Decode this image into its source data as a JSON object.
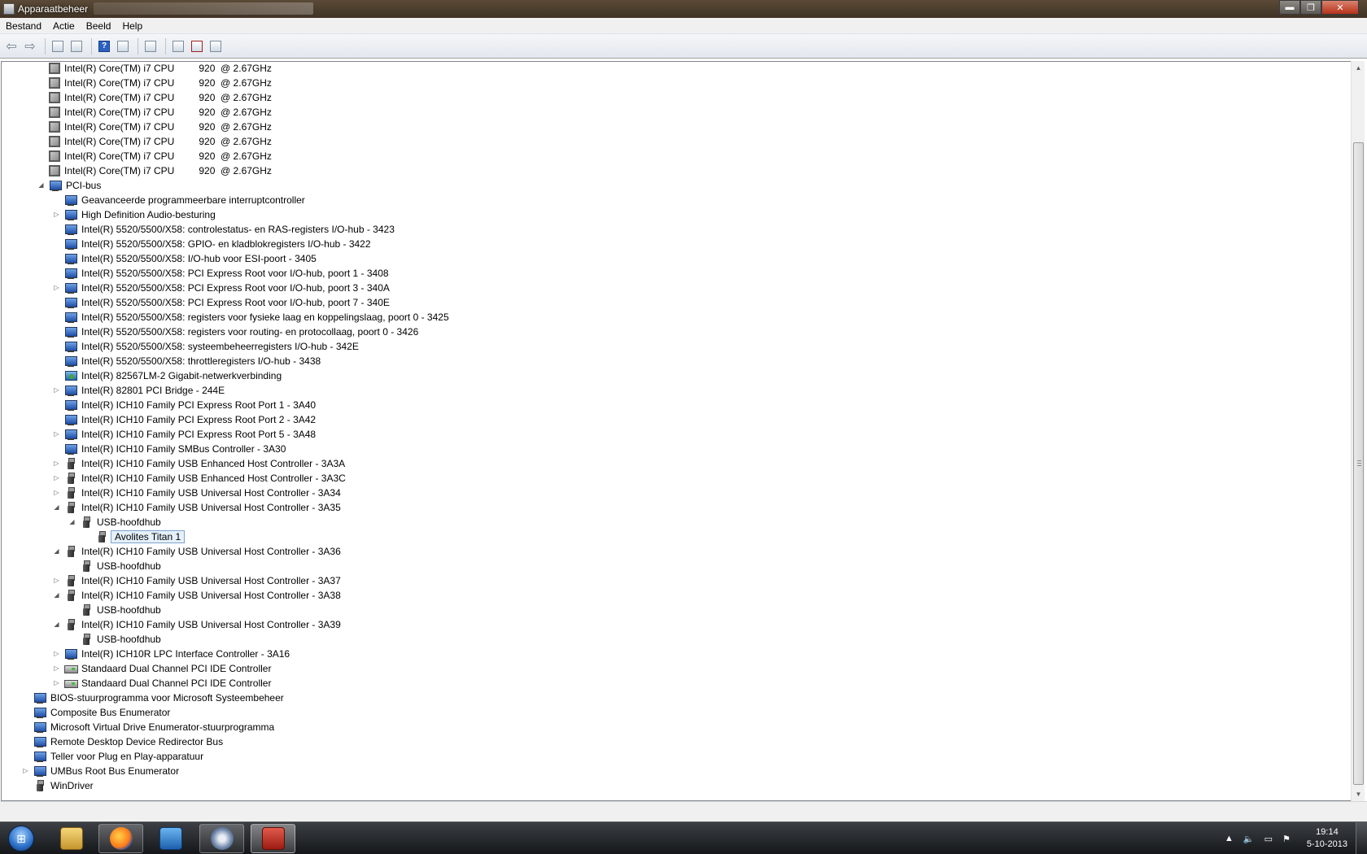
{
  "window": {
    "title": "Apparaatbeheer",
    "min_label": "▬",
    "max_label": "❐",
    "close_label": "✕"
  },
  "menu": [
    "Bestand",
    "Actie",
    "Beeld",
    "Help"
  ],
  "toolbar": {
    "icons": [
      "back-icon",
      "forward-icon",
      "console-tree-icon",
      "properties-icon",
      "help-icon",
      "show-hide-icon",
      "scan-hardware-icon",
      "update-driver-icon",
      "uninstall-icon",
      "disable-icon"
    ]
  },
  "tree": [
    {
      "label": "Intel(R) Core(TM) i7 CPU         920  @ 2.67GHz",
      "icon": "cpu",
      "level": 2,
      "expander": ""
    },
    {
      "label": "Intel(R) Core(TM) i7 CPU         920  @ 2.67GHz",
      "icon": "cpu",
      "level": 2,
      "expander": ""
    },
    {
      "label": "Intel(R) Core(TM) i7 CPU         920  @ 2.67GHz",
      "icon": "cpu",
      "level": 2,
      "expander": ""
    },
    {
      "label": "Intel(R) Core(TM) i7 CPU         920  @ 2.67GHz",
      "icon": "cpu",
      "level": 2,
      "expander": ""
    },
    {
      "label": "Intel(R) Core(TM) i7 CPU         920  @ 2.67GHz",
      "icon": "cpu",
      "level": 2,
      "expander": ""
    },
    {
      "label": "Intel(R) Core(TM) i7 CPU         920  @ 2.67GHz",
      "icon": "cpu",
      "level": 2,
      "expander": ""
    },
    {
      "label": "Intel(R) Core(TM) i7 CPU         920  @ 2.67GHz",
      "icon": "cpu",
      "level": 2,
      "expander": ""
    },
    {
      "label": "Intel(R) Core(TM) i7 CPU         920  @ 2.67GHz",
      "icon": "cpu",
      "level": 2,
      "expander": ""
    },
    {
      "label": "PCI-bus",
      "icon": "sys",
      "level": 2,
      "expander": "expanded"
    },
    {
      "label": "Geavanceerde programmeerbare interruptcontroller",
      "icon": "sys",
      "level": 3,
      "expander": ""
    },
    {
      "label": "High Definition Audio-besturing",
      "icon": "sys",
      "level": 3,
      "expander": "collapsed"
    },
    {
      "label": "Intel(R) 5520/5500/X58: controlestatus- en RAS-registers I/O-hub - 3423",
      "icon": "sys",
      "level": 3,
      "expander": ""
    },
    {
      "label": "Intel(R) 5520/5500/X58: GPIO- en kladblokregisters I/O-hub - 3422",
      "icon": "sys",
      "level": 3,
      "expander": ""
    },
    {
      "label": "Intel(R) 5520/5500/X58: I/O-hub voor ESI-poort - 3405",
      "icon": "sys",
      "level": 3,
      "expander": ""
    },
    {
      "label": "Intel(R) 5520/5500/X58: PCI Express Root voor I/O-hub, poort 1 - 3408",
      "icon": "sys",
      "level": 3,
      "expander": ""
    },
    {
      "label": "Intel(R) 5520/5500/X58: PCI Express Root voor I/O-hub, poort 3 - 340A",
      "icon": "sys",
      "level": 3,
      "expander": "collapsed"
    },
    {
      "label": "Intel(R) 5520/5500/X58: PCI Express Root voor I/O-hub, poort 7 - 340E",
      "icon": "sys",
      "level": 3,
      "expander": ""
    },
    {
      "label": "Intel(R) 5520/5500/X58: registers voor fysieke laag en koppelingslaag, poort 0 - 3425",
      "icon": "sys",
      "level": 3,
      "expander": ""
    },
    {
      "label": "Intel(R) 5520/5500/X58: registers voor routing- en protocollaag, poort 0 - 3426",
      "icon": "sys",
      "level": 3,
      "expander": ""
    },
    {
      "label": "Intel(R) 5520/5500/X58: systeembeheerregisters I/O-hub - 342E",
      "icon": "sys",
      "level": 3,
      "expander": ""
    },
    {
      "label": "Intel(R) 5520/5500/X58: throttleregisters I/O-hub - 3438",
      "icon": "sys",
      "level": 3,
      "expander": ""
    },
    {
      "label": "Intel(R) 82567LM-2 Gigabit-netwerkverbinding",
      "icon": "net",
      "level": 3,
      "expander": ""
    },
    {
      "label": "Intel(R) 82801 PCI Bridge - 244E",
      "icon": "sys",
      "level": 3,
      "expander": "collapsed"
    },
    {
      "label": "Intel(R) ICH10 Family PCI Express Root Port 1 - 3A40",
      "icon": "sys",
      "level": 3,
      "expander": ""
    },
    {
      "label": "Intel(R) ICH10 Family PCI Express Root Port 2 - 3A42",
      "icon": "sys",
      "level": 3,
      "expander": ""
    },
    {
      "label": "Intel(R) ICH10 Family PCI Express Root Port 5 - 3A48",
      "icon": "sys",
      "level": 3,
      "expander": "collapsed"
    },
    {
      "label": "Intel(R) ICH10 Family SMBus Controller - 3A30",
      "icon": "sys",
      "level": 3,
      "expander": ""
    },
    {
      "label": "Intel(R) ICH10 Family USB Enhanced Host Controller - 3A3A",
      "icon": "usb",
      "level": 3,
      "expander": "collapsed"
    },
    {
      "label": "Intel(R) ICH10 Family USB Enhanced Host Controller - 3A3C",
      "icon": "usb",
      "level": 3,
      "expander": "collapsed"
    },
    {
      "label": "Intel(R) ICH10 Family USB Universal Host Controller - 3A34",
      "icon": "usb",
      "level": 3,
      "expander": "collapsed"
    },
    {
      "label": "Intel(R) ICH10 Family USB Universal Host Controller - 3A35",
      "icon": "usb",
      "level": 3,
      "expander": "expanded"
    },
    {
      "label": "USB-hoofdhub",
      "icon": "usb",
      "level": 4,
      "expander": "expanded"
    },
    {
      "label": "Avolites Titan 1",
      "icon": "usb",
      "level": 5,
      "expander": "",
      "selected": true
    },
    {
      "label": "Intel(R) ICH10 Family USB Universal Host Controller - 3A36",
      "icon": "usb",
      "level": 3,
      "expander": "expanded"
    },
    {
      "label": "USB-hoofdhub",
      "icon": "usb",
      "level": 4,
      "expander": ""
    },
    {
      "label": "Intel(R) ICH10 Family USB Universal Host Controller - 3A37",
      "icon": "usb",
      "level": 3,
      "expander": "collapsed"
    },
    {
      "label": "Intel(R) ICH10 Family USB Universal Host Controller - 3A38",
      "icon": "usb",
      "level": 3,
      "expander": "expanded"
    },
    {
      "label": "USB-hoofdhub",
      "icon": "usb",
      "level": 4,
      "expander": ""
    },
    {
      "label": "Intel(R) ICH10 Family USB Universal Host Controller - 3A39",
      "icon": "usb",
      "level": 3,
      "expander": "expanded"
    },
    {
      "label": "USB-hoofdhub",
      "icon": "usb",
      "level": 4,
      "expander": ""
    },
    {
      "label": "Intel(R) ICH10R LPC Interface Controller - 3A16",
      "icon": "sys",
      "level": 3,
      "expander": "collapsed"
    },
    {
      "label": "Standaard Dual Channel PCI IDE Controller",
      "icon": "ide",
      "level": 3,
      "expander": "collapsed"
    },
    {
      "label": "Standaard Dual Channel PCI IDE Controller",
      "icon": "ide",
      "level": 3,
      "expander": "collapsed"
    },
    {
      "label": "BIOS-stuurprogramma voor Microsoft Systeembeheer",
      "icon": "sys",
      "level": 1,
      "expander": ""
    },
    {
      "label": "Composite Bus Enumerator",
      "icon": "sys",
      "level": 1,
      "expander": ""
    },
    {
      "label": "Microsoft Virtual Drive Enumerator-stuurprogramma",
      "icon": "sys",
      "level": 1,
      "expander": ""
    },
    {
      "label": "Remote Desktop Device Redirector Bus",
      "icon": "sys",
      "level": 1,
      "expander": ""
    },
    {
      "label": "Teller voor Plug en Play-apparatuur",
      "icon": "sys",
      "level": 1,
      "expander": ""
    },
    {
      "label": "UMBus Root Bus Enumerator",
      "icon": "sys",
      "level": 1,
      "expander": "collapsed"
    },
    {
      "label": "WinDriver",
      "icon": "usb",
      "level": 1,
      "expander": ""
    }
  ],
  "taskbar": {
    "start_label": "⊞",
    "apps": [
      {
        "name": "explorer",
        "state": ""
      },
      {
        "name": "firefox",
        "state": "active"
      },
      {
        "name": "media",
        "state": ""
      },
      {
        "name": "titan",
        "state": "active"
      },
      {
        "name": "devmgr",
        "state": "current"
      }
    ],
    "tray": {
      "arrow": "▲",
      "volume": "🔈",
      "network": "▭",
      "flag": "⚑"
    },
    "time": "19:14",
    "date": "5-10-2013"
  }
}
